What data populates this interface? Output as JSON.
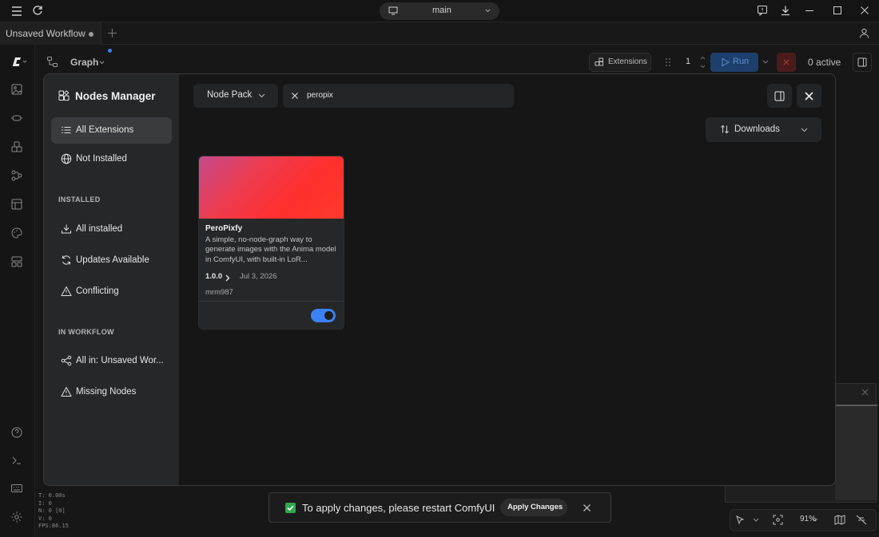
{
  "titlebar": {
    "branch": "main"
  },
  "tabs": [
    {
      "label": "Unsaved Workflow",
      "modified": true
    }
  ],
  "toolbar": {
    "graph_label": "Graph",
    "extensions_label": "Extensions",
    "queue_count": "1",
    "run_label": "Run",
    "active_label": "0 active"
  },
  "modal": {
    "title": "Nodes Manager",
    "nav": {
      "all_extensions": "All Extensions",
      "not_installed": "Not Installed",
      "installed_header": "INSTALLED",
      "all_installed": "All installed",
      "updates_available": "Updates Available",
      "conflicting": "Conflicting",
      "workflow_header": "IN WORKFLOW",
      "all_in_workflow": "All in: Unsaved Wor...",
      "missing_nodes": "Missing Nodes"
    },
    "filter_label": "Node Pack",
    "search_value": "peropix",
    "sort_label": "Downloads",
    "card": {
      "title": "PeroPixfy",
      "description": "A simple, no-node-graph way to generate images with the Anima model in ComfyUI, with built-in LoR...",
      "version": "1.0.0",
      "date": "Jul 3, 2026",
      "author": "mrm987",
      "enabled": true
    }
  },
  "toast": {
    "message": "To apply changes, please restart ComfyUI",
    "apply_label": "Apply Changes"
  },
  "stats": {
    "line1": "T: 0.00s",
    "line2": "I: 0",
    "line3": "N: 0 [0]",
    "line4": "V: 0",
    "line5": "FPS:86.15"
  },
  "canvas": {
    "zoom": "91%"
  },
  "colors": {
    "accent": "#3b82f6",
    "run_bg": "#1e3f6b",
    "success": "#2fa84f"
  }
}
